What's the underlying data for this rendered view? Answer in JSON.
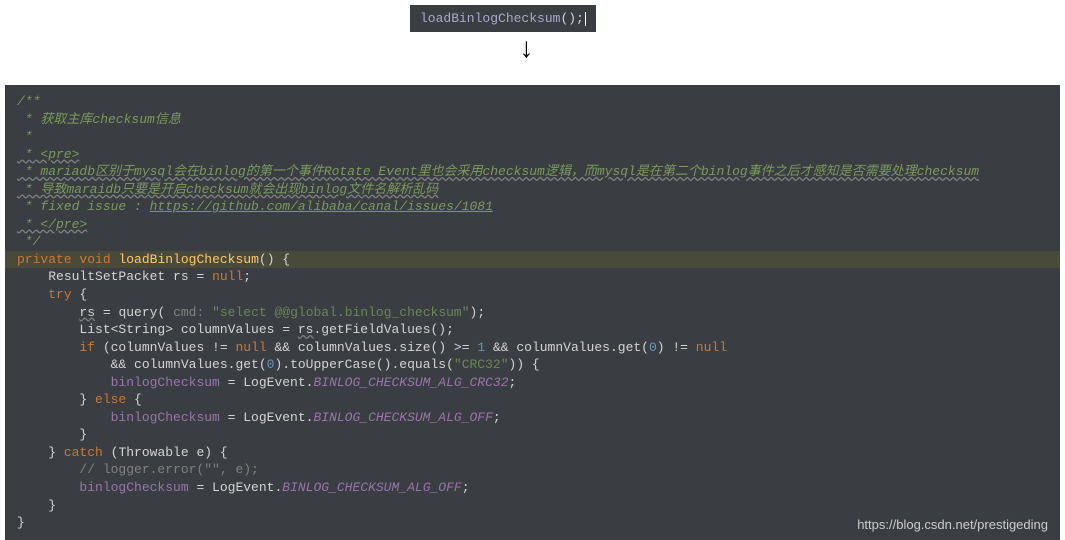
{
  "topSnippet": {
    "method": "loadBinlogChecksum",
    "paren": "();"
  },
  "arrow": "↓",
  "comments": {
    "l1": "/**",
    "l2": " * 获取主库checksum信息",
    "l3": " *",
    "l4": " * <pre>",
    "l5": " * mariadb区别于mysql会在binlog的第一个事件Rotate Event里也会采用checksum逻辑，而mysql是在第二个binlog事件之后才感知是否需要处理checksum",
    "l6": " * 导致maraidb只要是开启checksum就会出现binlog文件名解析乱码",
    "l7_prefix": " * fixed issue : ",
    "l7_link": "https://github.com/alibaba/canal/issues/1081",
    "l8": " * </pre>",
    "l9": " */"
  },
  "code": {
    "private": "private",
    "void": "void",
    "methodName": "loadBinlogChecksum",
    "openParen": "() {",
    "rsDecl_type": "ResultSetPacket ",
    "rsDecl_var": "rs",
    "rsDecl_rest": " = ",
    "null": "null",
    "semi": ";",
    "try": "try",
    "openBrace": " {",
    "rs_assign": "rs",
    "eq": " = ",
    "query": "query",
    "cmd_label": " cmd: ",
    "query_str": "\"select @@global.binlog_checksum\"",
    "list_type": "List<String> ",
    "columnValues": "columnValues = ",
    "rs2": "rs",
    "getField": ".getFieldValues();",
    "if": "if",
    "if_cond1": " (columnValues != ",
    "if_cond2": " && columnValues.size() >= ",
    "one": "1",
    "if_cond3": " && columnValues.get(",
    "zero": "0",
    "if_cond4": ") != ",
    "and_line": "    && columnValues.get(",
    "toUpper": ").toUpperCase().equals(",
    "crc32": "\"CRC32\"",
    "close_if": ")) {",
    "binlogChecksum": "binlogChecksum",
    "eq_log": " = LogEvent.",
    "alg_crc32": "BINLOG_CHECKSUM_ALG_CRC32",
    "else": "} else {",
    "alg_off": "BINLOG_CHECKSUM_ALG_OFF",
    "close": "}",
    "catch": "} catch",
    "catch_param": " (Throwable e) {",
    "logger_comment": "// logger.error(\"\", e);",
    "final_close": "}"
  },
  "watermark": "https://blog.csdn.net/prestigeding"
}
